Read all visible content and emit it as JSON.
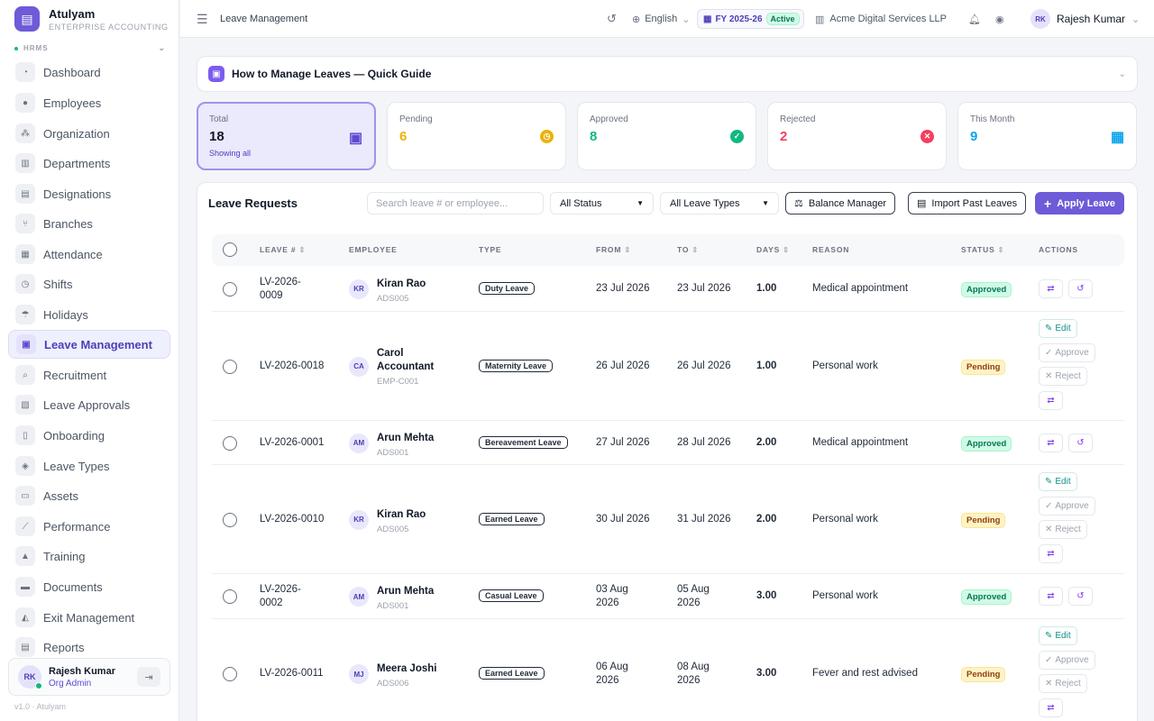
{
  "brand": {
    "name": "Atulyam",
    "subtitle": "ENTERPRISE ACCOUNTING"
  },
  "sidebar": {
    "section": "HRMS",
    "items": [
      {
        "label": "Dashboard",
        "icon": "dashboard-icon",
        "glyph": "◔"
      },
      {
        "label": "Employees",
        "icon": "users-icon",
        "glyph": "●"
      },
      {
        "label": "Organization",
        "icon": "org-chart-icon",
        "glyph": "⁂"
      },
      {
        "label": "Departments",
        "icon": "building-icon",
        "glyph": "▥"
      },
      {
        "label": "Designations",
        "icon": "badge-icon",
        "glyph": "▤"
      },
      {
        "label": "Branches",
        "icon": "branch-icon",
        "glyph": "⑂"
      },
      {
        "label": "Attendance",
        "icon": "attendance-icon",
        "glyph": "▦"
      },
      {
        "label": "Shifts",
        "icon": "clock-icon",
        "glyph": "◷"
      },
      {
        "label": "Holidays",
        "icon": "umbrella-icon",
        "glyph": "☂"
      },
      {
        "label": "Leave Management",
        "icon": "calendar-icon",
        "glyph": "▣",
        "active": true
      },
      {
        "label": "Recruitment",
        "icon": "search-user-icon",
        "glyph": "⌕"
      },
      {
        "label": "Leave Approvals",
        "icon": "clipboard-check-icon",
        "glyph": "▧"
      },
      {
        "label": "Onboarding",
        "icon": "door-icon",
        "glyph": "▯"
      },
      {
        "label": "Leave Types",
        "icon": "tag-icon",
        "glyph": "◈"
      },
      {
        "label": "Assets",
        "icon": "laptop-icon",
        "glyph": "▭"
      },
      {
        "label": "Performance",
        "icon": "chart-line-icon",
        "glyph": "⟋"
      },
      {
        "label": "Training",
        "icon": "graduation-cap-icon",
        "glyph": "▲"
      },
      {
        "label": "Documents",
        "icon": "folder-icon",
        "glyph": "▬"
      },
      {
        "label": "Exit Management",
        "icon": "user-exit-icon",
        "glyph": "◭"
      },
      {
        "label": "Reports",
        "icon": "report-icon",
        "glyph": "▤"
      }
    ]
  },
  "user": {
    "initials": "RK",
    "name": "Rajesh Kumar",
    "role": "Org Admin"
  },
  "version": "v1.0 · Atulyam",
  "topbar": {
    "breadcrumb": "Leave Management",
    "language": "English",
    "fiscal_year": "FY 2025-26",
    "fy_status": "Active",
    "company": "Acme Digital Services LLP",
    "user_initials": "RK",
    "user_name": "Rajesh Kumar"
  },
  "guide": {
    "title": "How to Manage Leaves — Quick Guide"
  },
  "stats": [
    {
      "label": "Total",
      "value": "18",
      "sub": "Showing all",
      "color": "#111827",
      "icon_color": "#5b4bd1"
    },
    {
      "label": "Pending",
      "value": "6",
      "color": "#eab308",
      "icon_color": "#eab308"
    },
    {
      "label": "Approved",
      "value": "8",
      "color": "#10b981",
      "icon_color": "#10b981"
    },
    {
      "label": "Rejected",
      "value": "2",
      "color": "#f43f5e",
      "icon_color": "#f43f5e"
    },
    {
      "label": "This Month",
      "value": "9",
      "color": "#0ea5e9",
      "icon_color": "#0ea5e9"
    }
  ],
  "requests": {
    "title": "Leave Requests",
    "search_placeholder": "Search leave # or employee...",
    "status_filter": "All Status",
    "type_filter": "All Leave Types",
    "balance_btn": "Balance Manager",
    "import_btn": "Import Past Leaves",
    "apply_btn": "Apply Leave",
    "columns": [
      "LEAVE #",
      "EMPLOYEE",
      "TYPE",
      "FROM",
      "TO",
      "DAYS",
      "REASON",
      "STATUS",
      "ACTIONS"
    ],
    "actions": {
      "edit": "Edit",
      "approve": "Approve",
      "reject": "Reject"
    },
    "rows": [
      {
        "leave_no": "LV-2026-0009",
        "initials": "KR",
        "name": "Kiran Rao",
        "emp_id": "ADS005",
        "type": "Duty Leave",
        "from": "23 Jul 2026",
        "to": "23 Jul 2026",
        "days": "1.00",
        "reason": "Medical appointment",
        "status": "Approved"
      },
      {
        "leave_no": "LV-2026-0018",
        "initials": "CA",
        "name": "Carol Accountant",
        "emp_id": "EMP-C001",
        "type": "Maternity Leave",
        "from": "26 Jul 2026",
        "to": "26 Jul 2026",
        "days": "1.00",
        "reason": "Personal work",
        "status": "Pending"
      },
      {
        "leave_no": "LV-2026-0001",
        "initials": "AM",
        "name": "Arun Mehta",
        "emp_id": "ADS001",
        "type": "Bereavement Leave",
        "from": "27 Jul 2026",
        "to": "28 Jul 2026",
        "days": "2.00",
        "reason": "Medical appointment",
        "status": "Approved"
      },
      {
        "leave_no": "LV-2026-0010",
        "initials": "KR",
        "name": "Kiran Rao",
        "emp_id": "ADS005",
        "type": "Earned Leave",
        "from": "30 Jul 2026",
        "to": "31 Jul 2026",
        "days": "2.00",
        "reason": "Personal work",
        "status": "Pending"
      },
      {
        "leave_no": "LV-2026-0002",
        "initials": "AM",
        "name": "Arun Mehta",
        "emp_id": "ADS001",
        "type": "Casual Leave",
        "from": "03 Aug 2026",
        "to": "05 Aug 2026",
        "days": "3.00",
        "reason": "Personal work",
        "status": "Approved"
      },
      {
        "leave_no": "LV-2026-0011",
        "initials": "MJ",
        "name": "Meera Joshi",
        "emp_id": "ADS006",
        "type": "Earned Leave",
        "from": "06 Aug 2026",
        "to": "08 Aug 2026",
        "days": "3.00",
        "reason": "Fever and rest advised",
        "status": "Pending"
      }
    ]
  }
}
